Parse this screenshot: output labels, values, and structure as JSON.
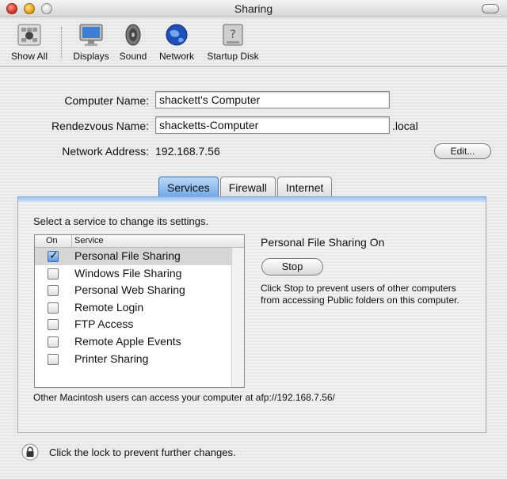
{
  "window": {
    "title": "Sharing"
  },
  "toolbar": {
    "items": [
      {
        "label": "Show All",
        "icon": "apple-icon"
      },
      {
        "label": "Displays",
        "icon": "monitor-icon"
      },
      {
        "label": "Sound",
        "icon": "speaker-icon"
      },
      {
        "label": "Network",
        "icon": "globe-icon"
      },
      {
        "label": "Startup Disk",
        "icon": "disk-icon"
      }
    ]
  },
  "form": {
    "computer_name_label": "Computer Name:",
    "computer_name_value": "shackett's Computer",
    "rendezvous_label": "Rendezvous Name:",
    "rendezvous_value": "shacketts-Computer",
    "rendezvous_suffix": ".local",
    "network_label": "Network Address:",
    "network_value": "192.168.7.56",
    "edit_label": "Edit..."
  },
  "tabs": [
    {
      "label": "Services",
      "active": true
    },
    {
      "label": "Firewall",
      "active": false
    },
    {
      "label": "Internet",
      "active": false
    }
  ],
  "services": {
    "intro": "Select a service to change its settings.",
    "col_on": "On",
    "col_service": "Service",
    "rows": [
      {
        "name": "Personal File Sharing",
        "on": true,
        "selected": true
      },
      {
        "name": "Windows File Sharing",
        "on": false
      },
      {
        "name": "Personal Web Sharing",
        "on": false
      },
      {
        "name": "Remote Login",
        "on": false
      },
      {
        "name": "FTP Access",
        "on": false
      },
      {
        "name": "Remote Apple Events",
        "on": false
      },
      {
        "name": "Printer Sharing",
        "on": false
      }
    ],
    "status": "Personal File Sharing On",
    "stop_label": "Stop",
    "description": "Click Stop to prevent users of other computers from accessing Public folders on this computer.",
    "afp_note": "Other Macintosh users can access your computer at afp://192.168.7.56/"
  },
  "footer": {
    "lock_text": "Click the lock to prevent further changes."
  },
  "colors": {
    "accent": "#6ea7e8",
    "checkbox_checked": "#5f98dc"
  }
}
